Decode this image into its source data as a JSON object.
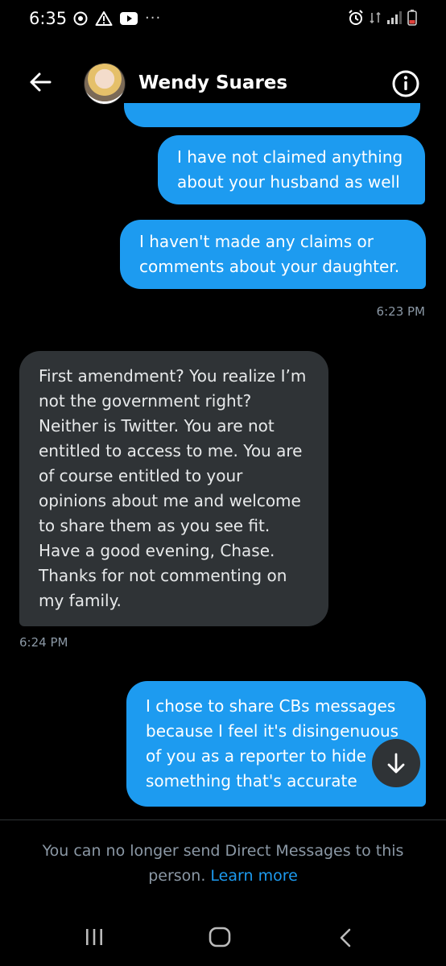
{
  "status_bar": {
    "time": "6:35",
    "dots": "···"
  },
  "header": {
    "contact_name": "Wendy Suares"
  },
  "messages": [
    {
      "direction": "sent",
      "text": "I have not claimed anything about your husband as well"
    },
    {
      "direction": "sent",
      "text": "I haven't made any claims or comments about your daughter."
    },
    {
      "timestamp": "6:23 PM"
    },
    {
      "direction": "received",
      "text": "First amendment? You realize I’m not the government right? Neither is Twitter. You are not entitled to access to me. You are of course entitled to your opinions about me and welcome to share them as you see fit. Have a good evening, Chase. Thanks for not commenting on my family."
    },
    {
      "timestamp": "6:24 PM"
    },
    {
      "direction": "sent",
      "text": "I chose to share CBs messages because I feel it's disingenuous of you as a reporter to hide something that's accurate"
    }
  ],
  "notice": {
    "text": "You can no longer send Direct Messages to this person.",
    "link": "Learn more"
  },
  "colors": {
    "sent_bubble": "#1d9bf0",
    "received_bubble": "#2f3336",
    "link": "#1d9bf0",
    "muted": "#8b98a5"
  }
}
